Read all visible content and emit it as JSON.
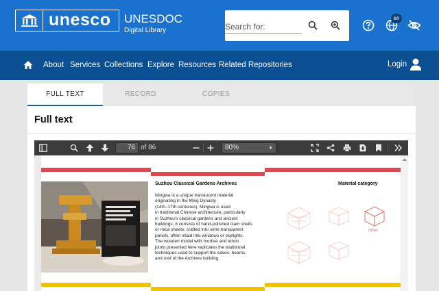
{
  "header": {
    "logo_text": "unesco",
    "site_name": "UNESDOC",
    "site_subtitle": "Digital Library",
    "search_placeholder": "Search for:",
    "language_badge": "en",
    "colors": {
      "primary": "#1a72ce",
      "nav": "#0b4f93"
    }
  },
  "nav": {
    "items": [
      "About",
      "Services",
      "Collections",
      "Explore",
      "Resources",
      "Related Repositories"
    ],
    "login_label": "Login"
  },
  "tabs": [
    {
      "label": "FULL TEXT",
      "active": true
    },
    {
      "label": "RECORD",
      "active": false
    },
    {
      "label": "COPIES",
      "active": false
    }
  ],
  "panel": {
    "title": "Full text"
  },
  "viewer": {
    "current_page": "76",
    "total_pages_text": "of 86",
    "zoom": "80%"
  },
  "document": {
    "heading": "Suzhou Classical Gardens Archives",
    "body_lines": [
      "Mingwa is a unique translucent material",
      "originating in the Ming Dynasty",
      "(14th–17th centuries). Mingwa is used",
      "in traditional Chinese architecture, particularly",
      "in Suzhou's classical gardens and ancient",
      "buildings. It consists of hand-polished clam shells",
      "or mica sheets, crafted into semi-transparent",
      "panels, often inlaid into windows or skylights.",
      "The wooden model with mortise and tenon",
      "joints presented here replicates the traditional",
      "techniques used to support the eaves, beams,",
      "and roof of the Archives building."
    ],
    "material_heading": "Material category",
    "material_label": "Other",
    "colors": {
      "red_bar": "#d94b50",
      "yellow_bar": "#f2c200",
      "material_active": "#e06060"
    }
  }
}
